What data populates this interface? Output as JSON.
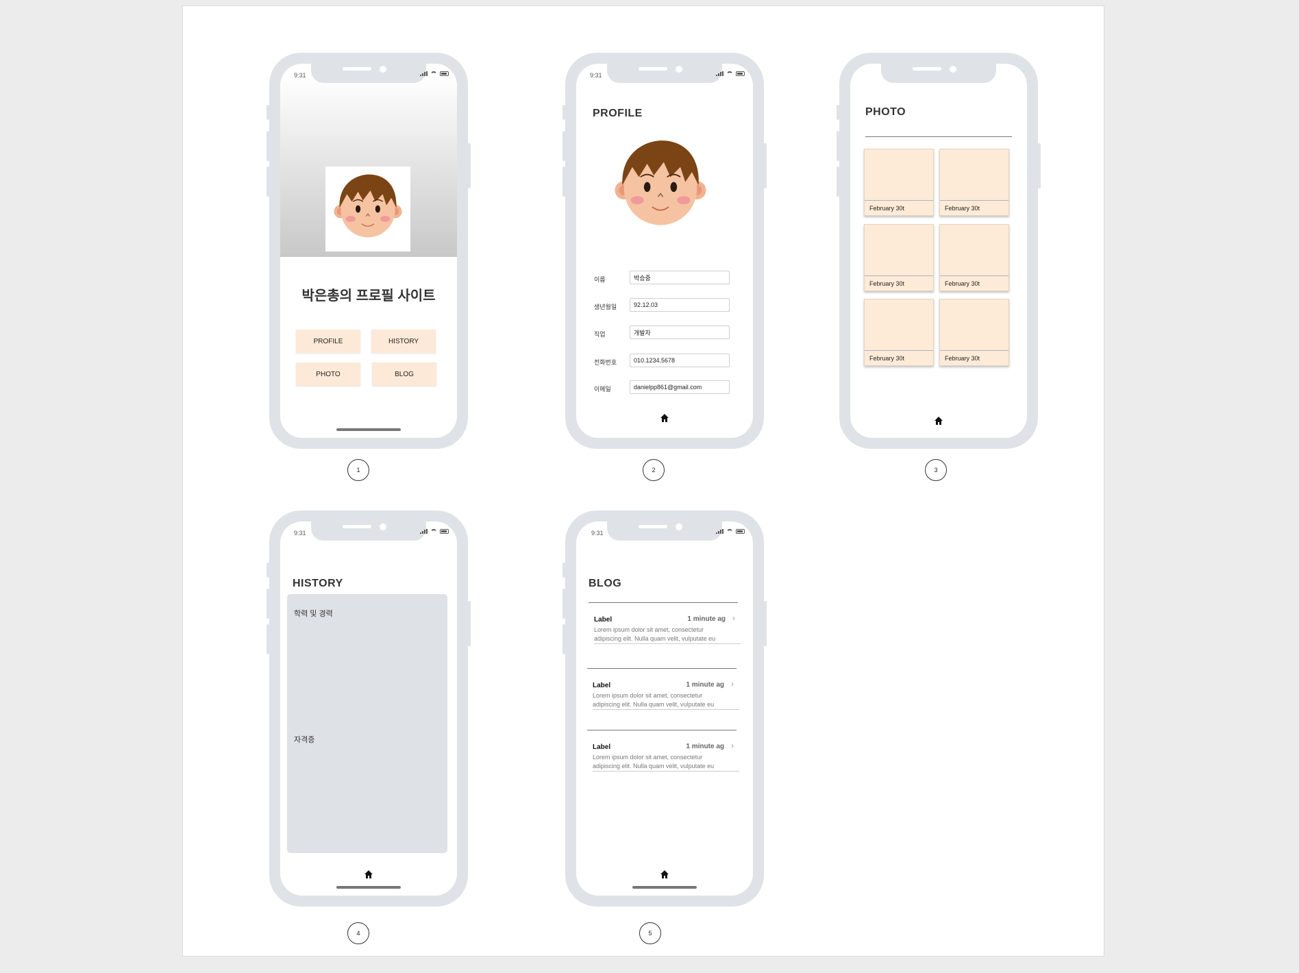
{
  "screens": {
    "home": {
      "status_time": "9:31",
      "site_title": "박은총의 프로필 사이트",
      "buttons": [
        "PROFILE",
        "HISTORY",
        "PHOTO",
        "BLOG"
      ],
      "page_number": "1"
    },
    "profile": {
      "status_time": "9:31",
      "title": "PROFILE",
      "fields": [
        {
          "label": "이름",
          "value": "박승중"
        },
        {
          "label": "생년월일",
          "value": "92.12.03"
        },
        {
          "label": "직업",
          "value": "개발자"
        },
        {
          "label": "전화번호",
          "value": "010.1234.5678"
        },
        {
          "label": "이메일",
          "value": "danielpp861@gmail.com"
        }
      ],
      "home_icon": "home-icon",
      "page_number": "2"
    },
    "photo": {
      "title": "PHOTO",
      "cards": [
        "February 30t",
        "February 30t",
        "February 30t",
        "February 30t",
        "February 30t",
        "February 30t"
      ],
      "home_icon": "home-icon",
      "page_number": "3"
    },
    "history": {
      "status_time": "9:31",
      "title": "HISTORY",
      "section1": "학력 및 경력",
      "section2": "자격증",
      "home_icon": "home-icon",
      "page_number": "4"
    },
    "blog": {
      "status_time": "9:31",
      "title": "BLOG",
      "items": [
        {
          "label": "Label",
          "time": "1 minute ag",
          "line1": "Lorem ipsum dolor sit amet, consectetur",
          "line2": "adipiscing elit. Nulla quam velit, vulputate eu"
        },
        {
          "label": "Label",
          "time": "1 minute ag",
          "line1": "Lorem ipsum dolor sit amet, consectetur",
          "line2": "adipiscing elit. Nulla quam velit, vulputate eu"
        },
        {
          "label": "Label",
          "time": "1 minute ag",
          "line1": "Lorem ipsum dolor sit amet, consectetur",
          "line2": "adipiscing elit. Nulla quam velit, vulputate eu"
        }
      ],
      "home_icon": "home-icon",
      "page_number": "5"
    }
  },
  "colors": {
    "phone_frame": "#dfe2e6",
    "button_bg": "#fde9d7",
    "photo_card_bg": "#fdebd7",
    "history_box": "#dee1e5",
    "canvas_bg": "#ececec"
  }
}
